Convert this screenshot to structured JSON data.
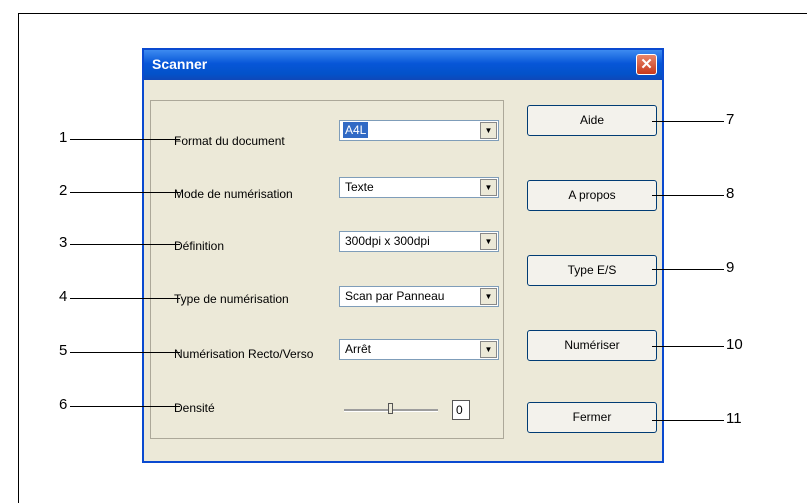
{
  "window": {
    "title": "Scanner",
    "close_glyph": "✕"
  },
  "fields": [
    {
      "label": "Format du document",
      "value": "A4L"
    },
    {
      "label": "Mode de numérisation",
      "value": "Texte"
    },
    {
      "label": "Définition",
      "value": "300dpi x 300dpi"
    },
    {
      "label": "Type de numérisation",
      "value": "Scan par Panneau"
    },
    {
      "label": "Numérisation Recto/Verso",
      "value": "Arrêt"
    }
  ],
  "density": {
    "label": "Densité",
    "value": "0"
  },
  "buttons": {
    "help": "Aide",
    "about": "A propos",
    "io_type": "Type E/S",
    "scan": "Numériser",
    "close": "Fermer"
  },
  "callouts": [
    "1",
    "2",
    "3",
    "4",
    "5",
    "6",
    "7",
    "8",
    "9",
    "10",
    "11"
  ],
  "colors": {
    "title_bar": "#0756d8",
    "selection": "#316ac5",
    "close_button": "#c8391c"
  }
}
